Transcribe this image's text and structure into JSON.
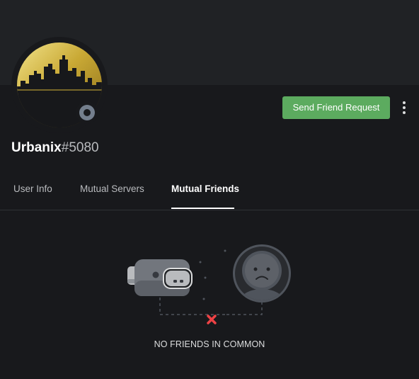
{
  "profile": {
    "username": "Urbanix",
    "discriminator": "#5080",
    "status": "offline",
    "avatar": "city-skyline-avatar"
  },
  "actions": {
    "send_friend_request": "Send Friend Request",
    "more_icon": "more-vertical-icon"
  },
  "tabs": [
    {
      "label": "User Info",
      "active": false
    },
    {
      "label": "Mutual Servers",
      "active": false
    },
    {
      "label": "Mutual Friends",
      "active": true
    }
  ],
  "empty_state": {
    "message": "NO FRIENDS IN COMMON"
  },
  "colors": {
    "background": "#18191c",
    "banner": "#202225",
    "accent_green": "#5cab5f",
    "avatar_gold": "#c9a935",
    "status_offline": "#747f8d",
    "x_red": "#ed4245"
  }
}
